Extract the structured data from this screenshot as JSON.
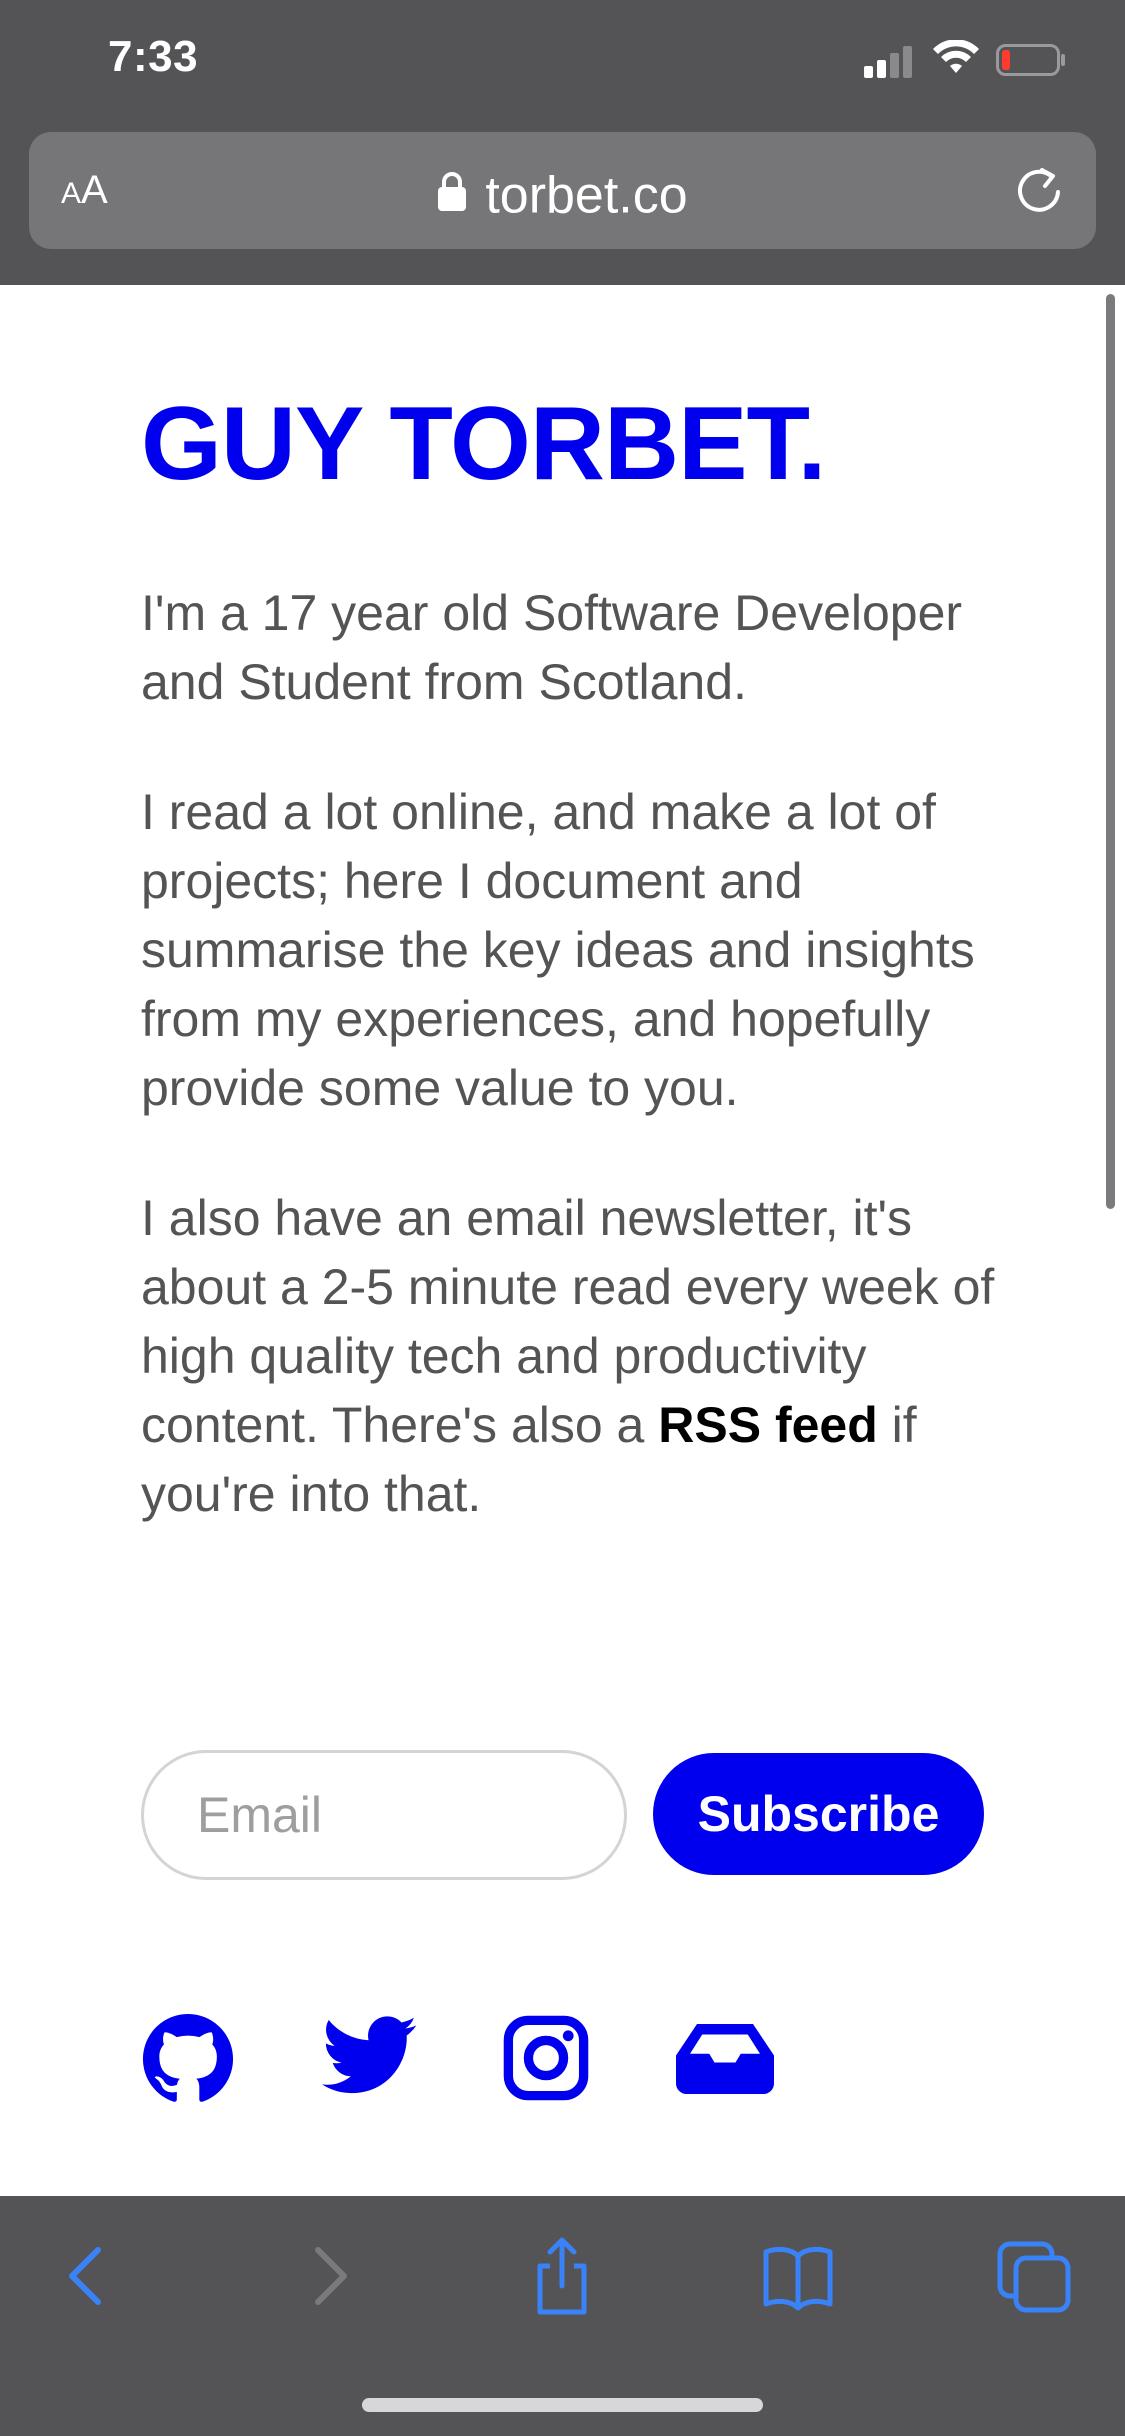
{
  "status_bar": {
    "time": "7:33"
  },
  "browser": {
    "text_size_button": {
      "small": "A",
      "large": "A"
    },
    "url": "torbet.co"
  },
  "page": {
    "title": "GUY TORBET.",
    "intro": "I'm a 17 year old Software Developer and Student from Scotland.",
    "about": "I read a lot online, and make a lot of projects; here I document and summarise the key ideas and insights from my experiences, and hopefully provide some value to you.",
    "newsletter_text_start": "I also have an email newsletter, it's about a 2-5 minute read every week of high quality tech and productivity content. There's also a ",
    "rss_link": "RSS feed",
    "newsletter_text_end": " if you're into that.",
    "email_placeholder": "Email",
    "subscribe_label": "Subscribe"
  },
  "social_links": [
    {
      "icon": "github-icon"
    },
    {
      "icon": "twitter-icon"
    },
    {
      "icon": "instagram-icon"
    },
    {
      "icon": "inbox-icon"
    }
  ],
  "colors": {
    "accent": "#0000ee",
    "text": "#545456",
    "chrome": "#545456",
    "toolbar_icon": "#3a82f7"
  }
}
